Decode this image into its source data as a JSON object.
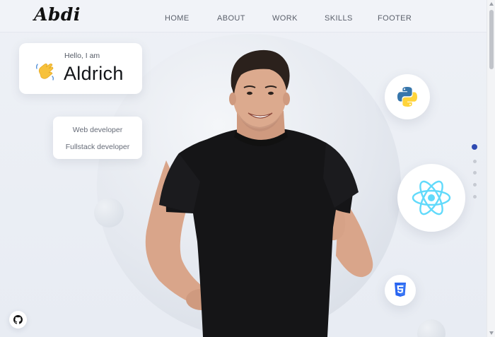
{
  "brand": {
    "logo": "Abdi"
  },
  "nav": {
    "items": [
      {
        "label": "HOME"
      },
      {
        "label": "ABOUT"
      },
      {
        "label": "WORK"
      },
      {
        "label": "SKILLS"
      },
      {
        "label": "FOOTER"
      }
    ]
  },
  "hero": {
    "greeting": "Hello, I am",
    "name": "Aldrich",
    "greeting_icon": "waving-hand-icon",
    "roles": [
      "Web developer",
      "Fullstack developer"
    ],
    "photo": "person-thumbs-up-photo"
  },
  "tech_icons": [
    {
      "name": "python-icon"
    },
    {
      "name": "react-icon"
    },
    {
      "name": "css3-icon"
    }
  ],
  "section_dots": {
    "count": 5,
    "active_index": 0
  },
  "social": {
    "github_icon": "github-icon"
  },
  "colors": {
    "accent": "#2f4ab2",
    "react": "#61dafb",
    "python_blue": "#3776ab",
    "python_yellow": "#ffd43b",
    "css_blue": "#2965f1"
  }
}
